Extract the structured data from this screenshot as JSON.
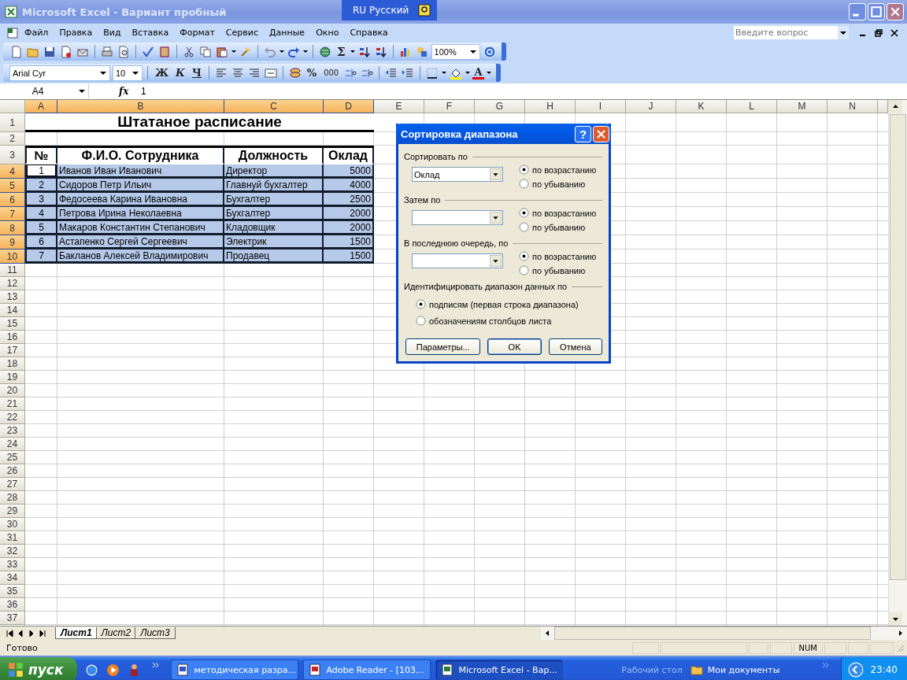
{
  "window": {
    "title": "Microsoft Excel - Вариант пробный"
  },
  "language_bar": {
    "label": "RU Русский"
  },
  "menu": [
    {
      "label": "Файл"
    },
    {
      "label": "Правка"
    },
    {
      "label": "Вид"
    },
    {
      "label": "Вставка"
    },
    {
      "label": "Формат"
    },
    {
      "label": "Сервис"
    },
    {
      "label": "Данные"
    },
    {
      "label": "Окно"
    },
    {
      "label": "Справка"
    }
  ],
  "help_search": {
    "placeholder": "Введите вопрос"
  },
  "standard_toolbar": {
    "sum": "Σ",
    "zoom": "100%"
  },
  "formatting_toolbar": {
    "font": "Arial Cyr",
    "size": "10",
    "bold": "Ж",
    "italic": "К",
    "underline": "Ч",
    "percent": "%",
    "thousands": "000",
    "font_color": "А"
  },
  "formula_bar": {
    "name_box": "A4",
    "function_label": "fx",
    "value": "1"
  },
  "sheet": {
    "columns": [
      {
        "label": "A",
        "selected": true
      },
      {
        "label": "B",
        "selected": true
      },
      {
        "label": "C",
        "selected": true
      },
      {
        "label": "D",
        "selected": true
      },
      {
        "label": "E",
        "selected": false
      },
      {
        "label": "F",
        "selected": false
      },
      {
        "label": "G",
        "selected": false
      },
      {
        "label": "H",
        "selected": false
      },
      {
        "label": "I",
        "selected": false
      },
      {
        "label": "J",
        "selected": false
      },
      {
        "label": "K",
        "selected": false
      },
      {
        "label": "L",
        "selected": false
      },
      {
        "label": "M",
        "selected": false
      },
      {
        "label": "N",
        "selected": false
      }
    ],
    "rows": [
      {
        "label": "1",
        "selected": false,
        "kind": "title",
        "cells": [
          {
            "text": "Штатаное расписание",
            "active": false
          }
        ]
      },
      {
        "label": "2",
        "selected": false,
        "kind": "blank"
      },
      {
        "label": "3",
        "selected": false,
        "kind": "header",
        "cells": [
          {
            "text": "№",
            "active": false
          },
          {
            "text": "Ф.И.О. Сотрудника",
            "active": false
          },
          {
            "text": "Должность",
            "active": false
          },
          {
            "text": "Оклад",
            "active": false
          }
        ]
      },
      {
        "label": "4",
        "selected": true,
        "kind": "data",
        "cells": [
          {
            "text": "1",
            "active": true
          },
          {
            "text": "Иванов Иван Иванович",
            "active": false
          },
          {
            "text": "Директор",
            "active": false
          },
          {
            "text": "5000",
            "active": false
          }
        ]
      },
      {
        "label": "5",
        "selected": true,
        "kind": "data",
        "cells": [
          {
            "text": "2",
            "active": false
          },
          {
            "text": "Сидоров Петр Ильич",
            "active": false
          },
          {
            "text": "Главнуй бухгалтер",
            "active": false
          },
          {
            "text": "4000",
            "active": false
          }
        ]
      },
      {
        "label": "6",
        "selected": true,
        "kind": "data",
        "cells": [
          {
            "text": "3",
            "active": false
          },
          {
            "text": "Федосеева Карина Ивановна",
            "active": false
          },
          {
            "text": "Бухгалтер",
            "active": false
          },
          {
            "text": "2500",
            "active": false
          }
        ]
      },
      {
        "label": "7",
        "selected": true,
        "kind": "data",
        "cells": [
          {
            "text": "4",
            "active": false
          },
          {
            "text": "Петрова Ирина Неколаевна",
            "active": false
          },
          {
            "text": "Бухгалтер",
            "active": false
          },
          {
            "text": "2000",
            "active": false
          }
        ]
      },
      {
        "label": "8",
        "selected": true,
        "kind": "data",
        "cells": [
          {
            "text": "5",
            "active": false
          },
          {
            "text": "Макаров Константин Степанович",
            "active": false
          },
          {
            "text": "Кладовщик",
            "active": false
          },
          {
            "text": "2000",
            "active": false
          }
        ]
      },
      {
        "label": "9",
        "selected": true,
        "kind": "data",
        "cells": [
          {
            "text": "6",
            "active": false
          },
          {
            "text": "Астапенко Сергей Сергеевич",
            "active": false
          },
          {
            "text": "Электрик",
            "active": false
          },
          {
            "text": "1500",
            "active": false
          }
        ]
      },
      {
        "label": "10",
        "selected": true,
        "kind": "data",
        "cells": [
          {
            "text": "7",
            "active": false
          },
          {
            "text": "Бакланов Алексей Владимирович",
            "active": false
          },
          {
            "text": "Продавец",
            "active": false
          },
          {
            "text": "1500",
            "active": false
          }
        ]
      },
      {
        "label": "11",
        "selected": false,
        "kind": "blank"
      },
      {
        "label": "12",
        "selected": false,
        "kind": "blank"
      },
      {
        "label": "13",
        "selected": false,
        "kind": "blank"
      },
      {
        "label": "14",
        "selected": false,
        "kind": "blank"
      },
      {
        "label": "15",
        "selected": false,
        "kind": "blank"
      },
      {
        "label": "16",
        "selected": false,
        "kind": "blank"
      },
      {
        "label": "17",
        "selected": false,
        "kind": "blank"
      },
      {
        "label": "18",
        "selected": false,
        "kind": "blank"
      },
      {
        "label": "19",
        "selected": false,
        "kind": "blank"
      },
      {
        "label": "20",
        "selected": false,
        "kind": "blank"
      },
      {
        "label": "21",
        "selected": false,
        "kind": "blank"
      },
      {
        "label": "22",
        "selected": false,
        "kind": "blank"
      },
      {
        "label": "23",
        "selected": false,
        "kind": "blank"
      },
      {
        "label": "24",
        "selected": false,
        "kind": "blank"
      },
      {
        "label": "25",
        "selected": false,
        "kind": "blank"
      },
      {
        "label": "26",
        "selected": false,
        "kind": "blank"
      },
      {
        "label": "27",
        "selected": false,
        "kind": "blank"
      },
      {
        "label": "28",
        "selected": false,
        "kind": "blank"
      },
      {
        "label": "29",
        "selected": false,
        "kind": "blank"
      },
      {
        "label": "30",
        "selected": false,
        "kind": "blank"
      },
      {
        "label": "31",
        "selected": false,
        "kind": "blank"
      },
      {
        "label": "32",
        "selected": false,
        "kind": "blank"
      },
      {
        "label": "33",
        "selected": false,
        "kind": "blank"
      },
      {
        "label": "34",
        "selected": false,
        "kind": "blank"
      },
      {
        "label": "35",
        "selected": false,
        "kind": "blank"
      },
      {
        "label": "36",
        "selected": false,
        "kind": "blank"
      },
      {
        "label": "37",
        "selected": false,
        "kind": "blank"
      }
    ]
  },
  "dialog": {
    "title": "Сортировка диапазона",
    "help_button": "?",
    "sort_keys": [
      {
        "label": "Сортировать по",
        "field": "Оклад",
        "options": [
          {
            "label": "по возрастанию",
            "selected": true
          },
          {
            "label": "по убыванию",
            "selected": false
          }
        ]
      },
      {
        "label": "Затем по",
        "options": [
          {
            "label": "по возрастанию",
            "selected": true
          },
          {
            "label": "по убыванию",
            "selected": false
          }
        ]
      },
      {
        "label": "В последнюю очередь, по",
        "options": [
          {
            "label": "по возрастанию",
            "selected": true
          },
          {
            "label": "по убыванию",
            "selected": false
          }
        ]
      }
    ],
    "identify": {
      "label": "Идентифицировать диапазон данных по",
      "options": [
        {
          "label": "подписям (первая строка диапазона)",
          "selected": true
        },
        {
          "label": "обозначениям столбцов листа",
          "selected": false
        }
      ]
    },
    "buttons": [
      {
        "label": "Параметры...",
        "default": false
      },
      {
        "label": "OK",
        "default": true
      },
      {
        "label": "Отмена",
        "default": false
      }
    ]
  },
  "sheet_tabs": [
    {
      "label": "Лист1",
      "selected": true
    },
    {
      "label": "Лист2",
      "selected": false
    },
    {
      "label": "Лист3",
      "selected": false
    }
  ],
  "status_bar": {
    "text": "Готово",
    "indicators": [
      "NUM"
    ]
  },
  "taskbar": {
    "start": "пуск",
    "tasks": [
      {
        "label": "методическая разра...",
        "selected": false
      },
      {
        "label": "Adobe Reader - [103...",
        "selected": false
      },
      {
        "label": "Microsoft Excel - Вар...",
        "selected": true
      }
    ],
    "toolbar_label": "Рабочий стол",
    "folder": "Мои документы",
    "clock": "23:40"
  }
}
